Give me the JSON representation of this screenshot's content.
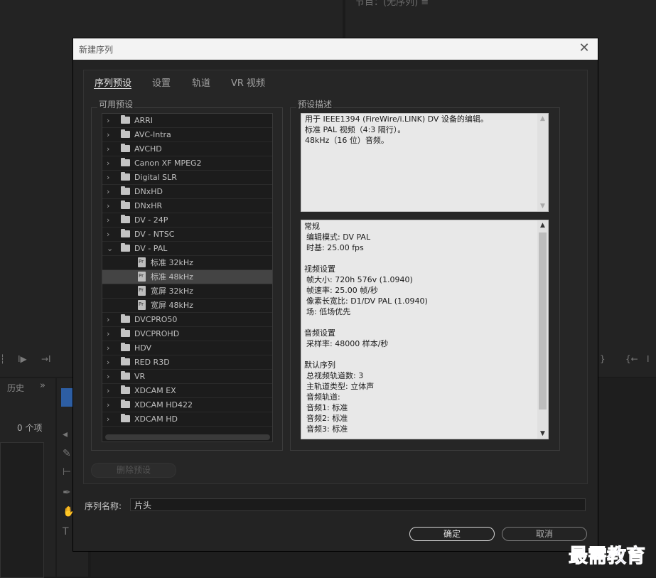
{
  "background": {
    "sequence_title": "节目：(无序列) ≡",
    "history_tab": "历史",
    "chevron": "»",
    "item_count": "0 个项"
  },
  "dialog": {
    "title": "新建序列",
    "close_icon": "close-icon",
    "tabs": [
      "序列预设",
      "设置",
      "轨道",
      "VR 视频"
    ],
    "available_presets_label": "可用预设",
    "preset_description_label": "预设描述",
    "presets": [
      {
        "label": "ARRI",
        "type": "folder",
        "expanded": false
      },
      {
        "label": "AVC-Intra",
        "type": "folder",
        "expanded": false
      },
      {
        "label": "AVCHD",
        "type": "folder",
        "expanded": false
      },
      {
        "label": "Canon XF MPEG2",
        "type": "folder",
        "expanded": false
      },
      {
        "label": "Digital SLR",
        "type": "folder",
        "expanded": false
      },
      {
        "label": "DNxHD",
        "type": "folder",
        "expanded": false
      },
      {
        "label": "DNxHR",
        "type": "folder",
        "expanded": false
      },
      {
        "label": "DV - 24P",
        "type": "folder",
        "expanded": false
      },
      {
        "label": "DV - NTSC",
        "type": "folder",
        "expanded": false
      },
      {
        "label": "DV - PAL",
        "type": "folder",
        "expanded": true
      },
      {
        "label": "标准 32kHz",
        "type": "preset",
        "selected": false
      },
      {
        "label": "标准 48kHz",
        "type": "preset",
        "selected": true
      },
      {
        "label": "宽屏 32kHz",
        "type": "preset",
        "selected": false
      },
      {
        "label": "宽屏 48kHz",
        "type": "preset",
        "selected": false
      },
      {
        "label": "DVCPRO50",
        "type": "folder",
        "expanded": false
      },
      {
        "label": "DVCPROHD",
        "type": "folder",
        "expanded": false
      },
      {
        "label": "HDV",
        "type": "folder",
        "expanded": false
      },
      {
        "label": "RED R3D",
        "type": "folder",
        "expanded": false
      },
      {
        "label": "VR",
        "type": "folder",
        "expanded": false
      },
      {
        "label": "XDCAM EX",
        "type": "folder",
        "expanded": false
      },
      {
        "label": "XDCAM HD422",
        "type": "folder",
        "expanded": false
      },
      {
        "label": "XDCAM HD",
        "type": "folder",
        "expanded": false
      }
    ],
    "description_lines": [
      "用于 IEEE1394 (FireWire/i.LINK) DV 设备的编辑。",
      "标准 PAL 视频（4:3 隔行）。",
      "48kHz（16 位）音频。"
    ],
    "info_lines": [
      {
        "text": "常规",
        "kind": "head"
      },
      {
        "text": "编辑模式: DV PAL",
        "kind": "item"
      },
      {
        "text": "时基: 25.00 fps",
        "kind": "item"
      },
      {
        "text": "",
        "kind": "blank"
      },
      {
        "text": "视频设置",
        "kind": "head"
      },
      {
        "text": "帧大小: 720h 576v (1.0940)",
        "kind": "item"
      },
      {
        "text": "帧速率: 25.00  帧/秒",
        "kind": "item"
      },
      {
        "text": "像素长宽比: D1/DV PAL (1.0940)",
        "kind": "item"
      },
      {
        "text": "场: 低场优先",
        "kind": "item"
      },
      {
        "text": "",
        "kind": "blank"
      },
      {
        "text": "音频设置",
        "kind": "head"
      },
      {
        "text": "采样率: 48000 样本/秒",
        "kind": "item"
      },
      {
        "text": "",
        "kind": "blank"
      },
      {
        "text": "默认序列",
        "kind": "head"
      },
      {
        "text": "总视频轨道数: 3",
        "kind": "item"
      },
      {
        "text": "主轨道类型: 立体声",
        "kind": "item"
      },
      {
        "text": "音频轨道:",
        "kind": "item"
      },
      {
        "text": "音频1: 标准",
        "kind": "item"
      },
      {
        "text": "音频2: 标准",
        "kind": "item"
      },
      {
        "text": "音频3: 标准",
        "kind": "item"
      }
    ],
    "delete_preset_label": "删除预设",
    "sequence_name_label": "序列名称:",
    "sequence_name_value": "片头",
    "ok_label": "确定",
    "cancel_label": "取消"
  },
  "watermark": "最需教育"
}
